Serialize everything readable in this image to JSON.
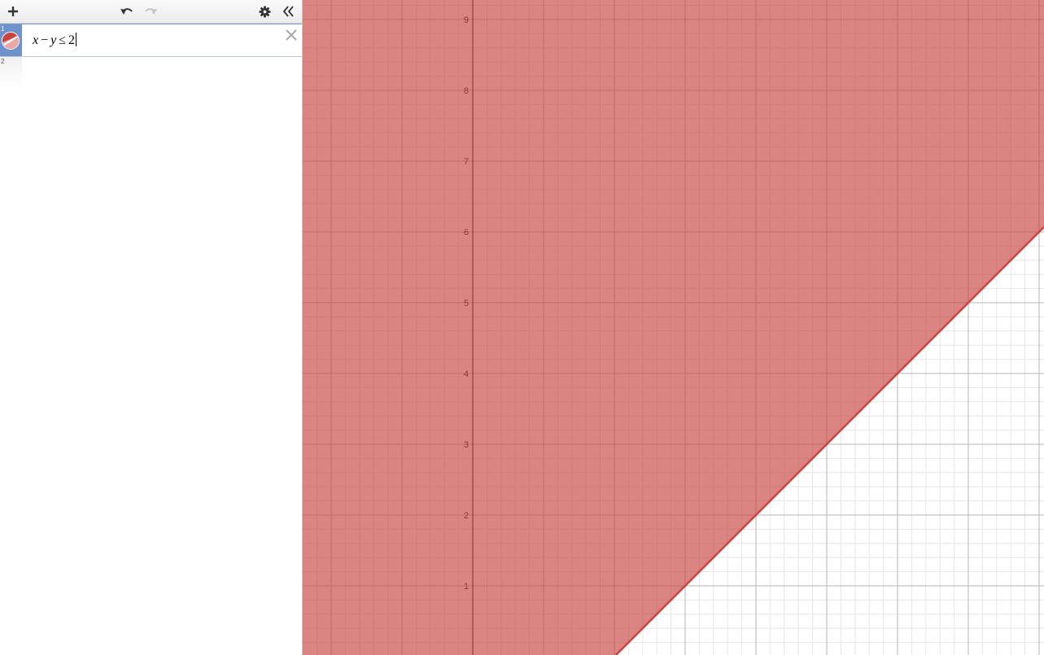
{
  "toolbar": {
    "add_icon": "plus-icon",
    "undo_icon": "undo-icon",
    "redo_icon": "redo-icon",
    "settings_icon": "gear-icon",
    "collapse_icon": "double-chevron-left-icon"
  },
  "expressions": [
    {
      "number": "1",
      "lhs_var1": "x",
      "op1": "−",
      "lhs_var2": "y",
      "relation": "≤",
      "rhs": "2",
      "color": "#c74440",
      "icon": "inequality-color-icon",
      "delete_icon": "close-icon"
    },
    {
      "number": "2"
    }
  ],
  "graph": {
    "shade_color": "#c74440",
    "y_ticks": [
      "1",
      "2",
      "3",
      "4",
      "5",
      "6",
      "7",
      "8",
      "9"
    ]
  }
}
